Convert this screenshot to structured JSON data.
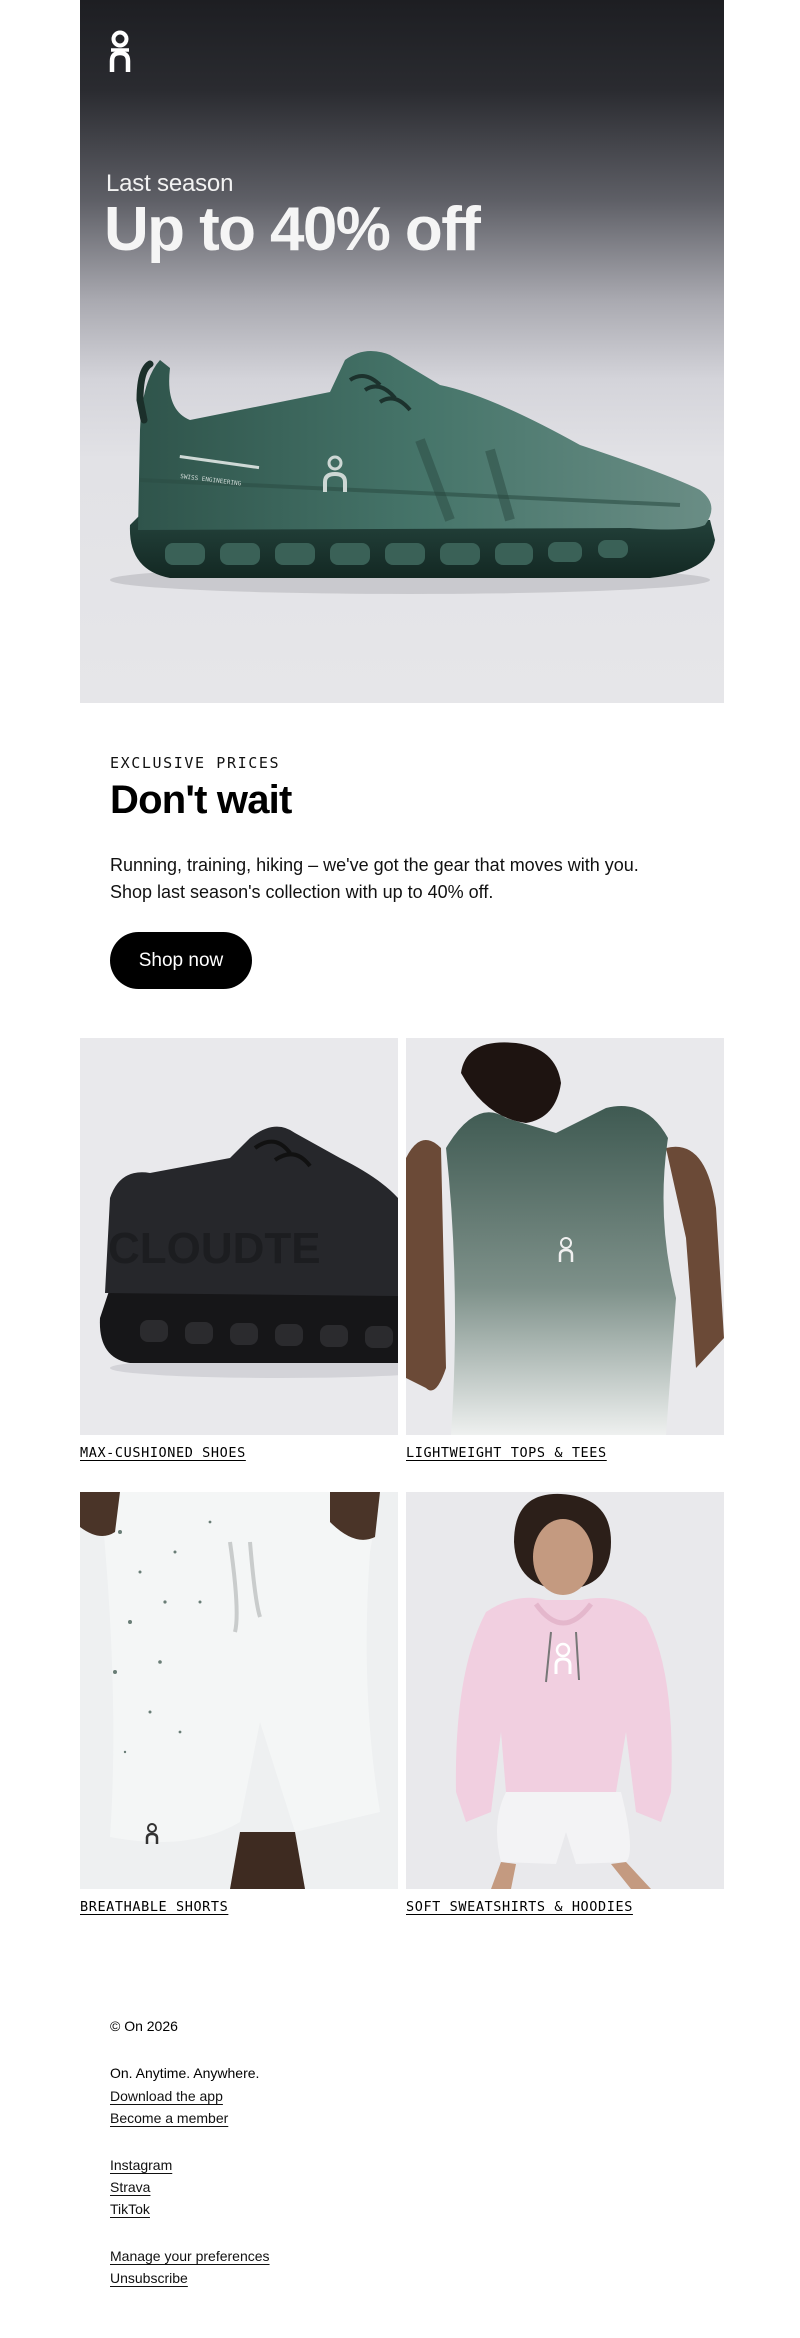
{
  "brand": {
    "logo": "On",
    "logo_icon": "on-logo-icon"
  },
  "hero": {
    "eyebrow": "Last season",
    "title": "Up to 40% off",
    "shoe_text": "SWISS ENGINEERING"
  },
  "intro": {
    "eyebrow": "EXCLUSIVE PRICES",
    "headline": "Don't wait",
    "body_line1": "Running, training, hiking – we've got the gear that moves with you.",
    "body_line2": "Shop last season's collection with up to 40% off.",
    "cta_label": "Shop now"
  },
  "categories": [
    {
      "label": "MAX-CUSHIONED SHOES",
      "image_text": "CLOUDTE"
    },
    {
      "label": "LIGHTWEIGHT TOPS & TEES"
    },
    {
      "label": "BREATHABLE SHORTS"
    },
    {
      "label": "SOFT SWEATSHIRTS & HOODIES"
    }
  ],
  "footer": {
    "copyright": "© On 2026",
    "tagline": "On. Anytime. Anywhere.",
    "links_app": [
      "Download the app",
      "Become a member"
    ],
    "links_social": [
      "Instagram",
      "Strava",
      "TikTok"
    ],
    "links_manage": [
      "Manage your preferences",
      "Unsubscribe"
    ]
  },
  "colors": {
    "hero_dark": "#1d1e22",
    "shoe_green": "#3f6b60",
    "cta_bg": "#000000",
    "tile_bg": "#e9e9ec"
  }
}
